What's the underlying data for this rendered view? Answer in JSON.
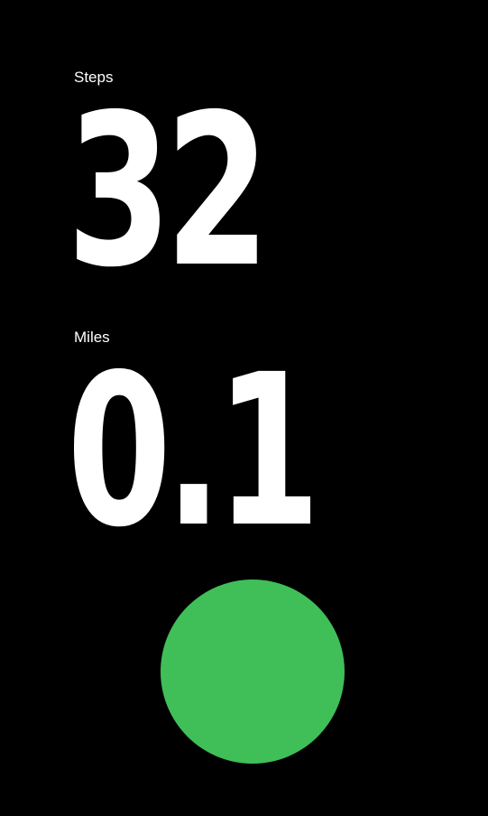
{
  "steps": {
    "label": "Steps",
    "value": "32"
  },
  "miles": {
    "label": "Miles",
    "value": "0.1"
  },
  "colors": {
    "background": "#000000",
    "text": "#ffffff",
    "action_circle": "#40bf58"
  }
}
